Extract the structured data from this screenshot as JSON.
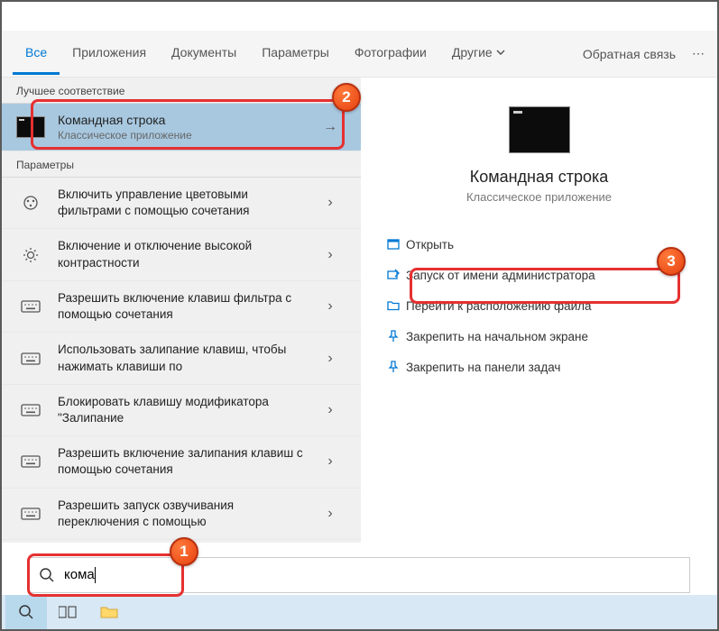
{
  "header": {
    "tabs": [
      "Все",
      "Приложения",
      "Документы",
      "Параметры",
      "Фотографии",
      "Другие"
    ],
    "feedback": "Обратная связь"
  },
  "left": {
    "best_match_header": "Лучшее соответствие",
    "best_match": {
      "title": "Командная строка",
      "subtitle": "Классическое приложение"
    },
    "settings_header": "Параметры",
    "settings": [
      "Включить управление цветовыми фильтрами с помощью сочетания",
      "Включение и отключение высокой контрастности",
      "Разрешить включение клавиш фильтра с помощью сочетания",
      "Использовать залипание клавиш, чтобы нажимать клавиши по",
      "Блокировать клавишу модификатора \"Залипание",
      "Разрешить включение залипания клавиш с помощью сочетания",
      "Разрешить запуск озвучивания переключения с помощью"
    ]
  },
  "right": {
    "title": "Командная строка",
    "subtitle": "Классическое приложение",
    "actions": [
      {
        "icon": "open",
        "label": "Открыть"
      },
      {
        "icon": "admin",
        "label": "Запуск от имени администратора"
      },
      {
        "icon": "folder",
        "label": "Перейти к расположению файла"
      },
      {
        "icon": "pin",
        "label": "Закрепить на начальном экране"
      },
      {
        "icon": "pin",
        "label": "Закрепить на панели задач"
      }
    ]
  },
  "search": {
    "value": "кома"
  },
  "badges": {
    "b1": "1",
    "b2": "2",
    "b3": "3"
  },
  "setting_icons": [
    "palette",
    "sun",
    "keyboard",
    "keyboard",
    "keyboard",
    "keyboard",
    "keyboard"
  ]
}
